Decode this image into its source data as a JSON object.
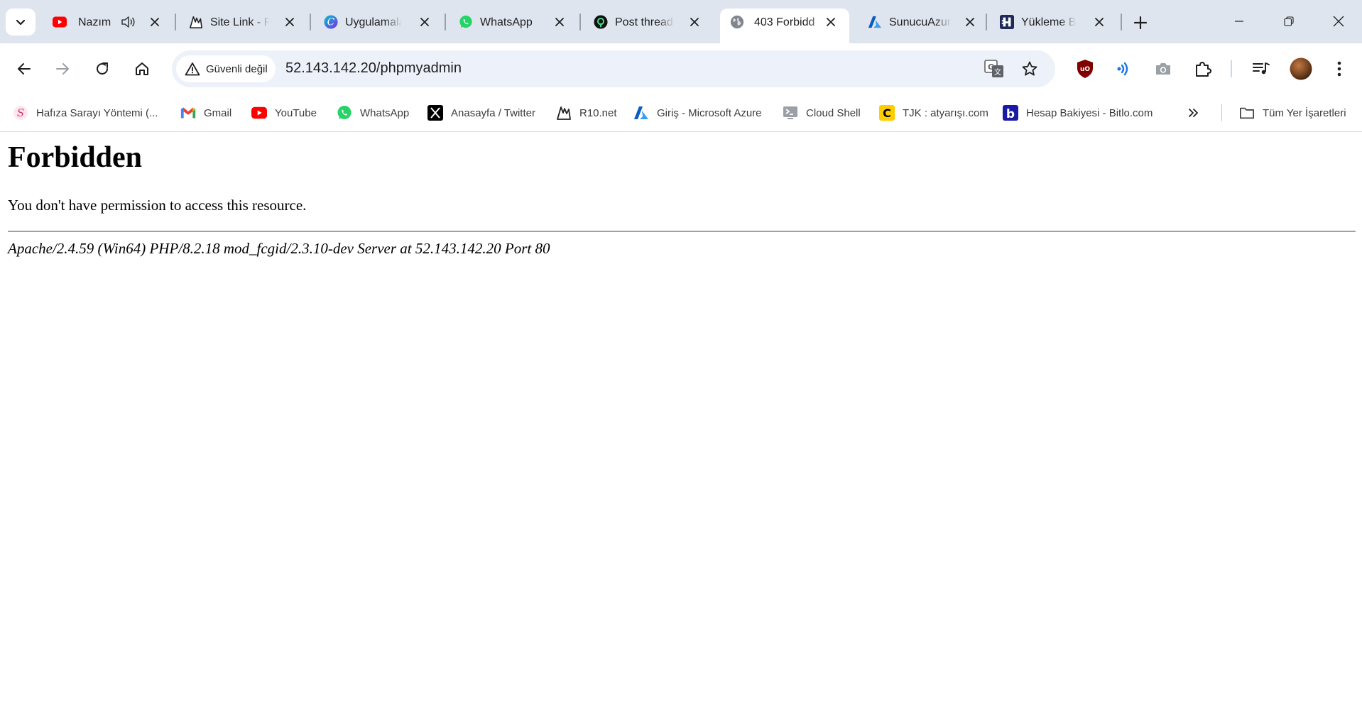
{
  "tabs": [
    {
      "title": "Nazım",
      "icon": "youtube-icon",
      "audio": true
    },
    {
      "title": "Site Link - R",
      "icon": "r10-icon"
    },
    {
      "title": "Uygulamala",
      "icon": "canva-icon"
    },
    {
      "title": "WhatsApp",
      "icon": "whatsapp-icon"
    },
    {
      "title": "Post thread",
      "icon": "threads-icon"
    },
    {
      "title": "403 Forbidd",
      "icon": "globe-icon",
      "active": true
    },
    {
      "title": "SunucuAzur",
      "icon": "azure-icon"
    },
    {
      "title": "Yükleme Ba",
      "icon": "hostinger-icon"
    }
  ],
  "toolbar": {
    "security_label": "Güvenli değil",
    "url": "52.143.142.20/phpmyadmin"
  },
  "bookmarks": [
    {
      "label": "Hafıza Sarayı Yöntemi (...",
      "icon": "hafiza-icon"
    },
    {
      "label": "Gmail",
      "icon": "gmail-icon"
    },
    {
      "label": "YouTube",
      "icon": "youtube-icon"
    },
    {
      "label": "WhatsApp",
      "icon": "whatsapp-icon"
    },
    {
      "label": "Anasayfa / Twitter",
      "icon": "x-icon"
    },
    {
      "label": "R10.net",
      "icon": "r10-icon"
    },
    {
      "label": "Giriş - Microsoft Azure",
      "icon": "azure-icon"
    },
    {
      "label": "Cloud Shell",
      "icon": "cloud-shell-icon"
    },
    {
      "label": "TJK : atyarışı.com",
      "icon": "tjk-icon"
    },
    {
      "label": "Hesap Bakiyesi - Bitlo.com",
      "icon": "bitlo-icon"
    }
  ],
  "all_bookmarks_label": "Tüm Yer İşaretleri",
  "page": {
    "heading": "Forbidden",
    "message": "You don't have permission to access this resource.",
    "server_signature": "Apache/2.4.59 (Win64) PHP/8.2.18 mod_fcgid/2.3.10-dev Server at 52.143.142.20 Port 80"
  },
  "colors": {
    "tabstrip": "#dfe5ef",
    "omnibox": "#edf2fa",
    "accent": "#1a73e8"
  }
}
